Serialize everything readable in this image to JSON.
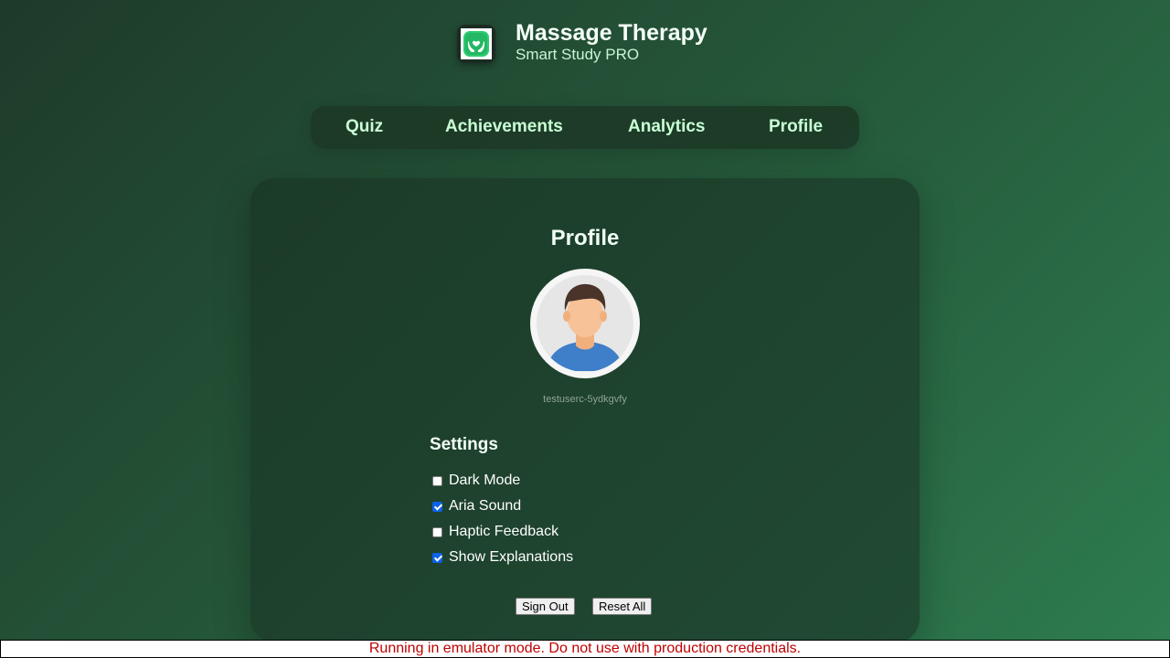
{
  "header": {
    "title": "Massage Therapy",
    "subtitle": "Smart Study PRO",
    "icon": "hands-heart-icon"
  },
  "nav": {
    "items": [
      {
        "label": "Quiz"
      },
      {
        "label": "Achievements"
      },
      {
        "label": "Analytics"
      },
      {
        "label": "Profile"
      }
    ]
  },
  "profile": {
    "title": "Profile",
    "avatar_icon": "user-avatar-icon",
    "username": "testuserc-5ydkgvfy"
  },
  "settings": {
    "title": "Settings",
    "options": [
      {
        "label": "Dark Mode",
        "checked": false
      },
      {
        "label": "Aria Sound",
        "checked": true
      },
      {
        "label": "Haptic Feedback",
        "checked": false
      },
      {
        "label": "Show Explanations",
        "checked": true
      }
    ]
  },
  "actions": {
    "sign_out": "Sign Out",
    "reset_all": "Reset All"
  },
  "banner": {
    "text": "Running in emulator mode. Do not use with production credentials."
  },
  "colors": {
    "accent_green": "#2ecc71",
    "nav_text": "#c9ffd4",
    "checkbox_blue": "#0b63e8",
    "banner_text": "#c00000"
  }
}
